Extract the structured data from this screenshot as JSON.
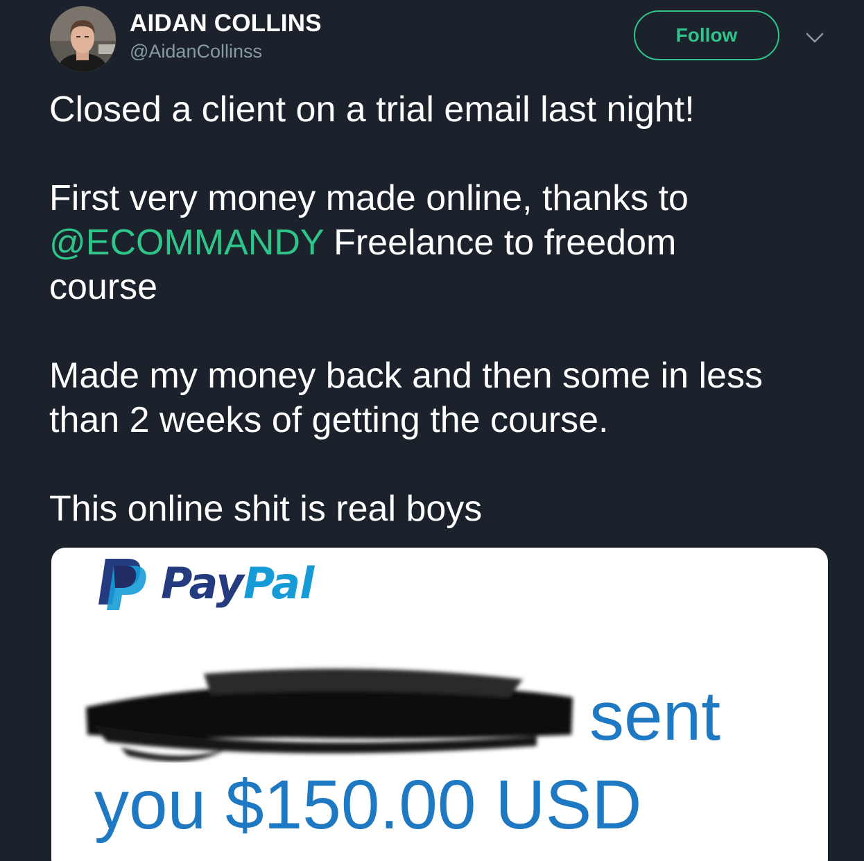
{
  "user": {
    "name": "AIDAN COLLINS",
    "handle": "@AidanCollinss"
  },
  "follow_button": {
    "label": "Follow"
  },
  "tweet": {
    "line1": "Closed a client on a trial email last night!",
    "line2": "First very money made online, thanks to",
    "mention": "@ECOMMANDY",
    "line3_rest": " Freelance to freedom",
    "line4": "course",
    "line5": "Made my money back and then some in less",
    "line6": "than 2 weeks of getting the course.",
    "line7": "This online shit is real boys"
  },
  "media": {
    "brand_part1": "Pay",
    "brand_part2": "Pal",
    "sent_text": "sent",
    "amount_text": "you $150.00 USD"
  },
  "colors": {
    "background": "#1b222c",
    "accent": "#2ec48a",
    "paypal_dark": "#253b80",
    "paypal_light": "#179bd7",
    "amount_blue": "#1f79c2"
  },
  "icons": {
    "menu": "chevron-down-icon",
    "logo": "paypal-logo-icon"
  }
}
